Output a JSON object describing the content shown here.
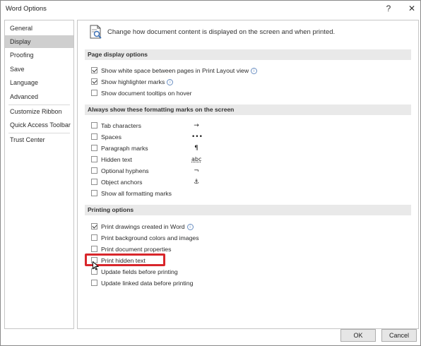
{
  "window": {
    "title": "Word Options",
    "help": "?",
    "close": "✕"
  },
  "sidebar": {
    "items": [
      {
        "label": "General"
      },
      {
        "label": "Display"
      },
      {
        "label": "Proofing"
      },
      {
        "label": "Save"
      },
      {
        "label": "Language"
      },
      {
        "label": "Advanced"
      },
      {
        "label": "Customize Ribbon"
      },
      {
        "label": "Quick Access Toolbar"
      },
      {
        "label": "Trust Center"
      }
    ],
    "selected": "Display"
  },
  "main": {
    "header": "Change how document content is displayed on the screen and when printed.",
    "sections": [
      {
        "title": "Page display options",
        "options": [
          {
            "label": "Show white space between pages in Print Layout view",
            "checked": true,
            "info": true
          },
          {
            "label": "Show highlighter marks",
            "checked": true,
            "info": true
          },
          {
            "label": "Show document tooltips on hover",
            "checked": false,
            "info": false
          }
        ]
      },
      {
        "title": "Always show these formatting marks on the screen",
        "options": [
          {
            "label": "Tab characters",
            "checked": false,
            "symbol": "→"
          },
          {
            "label": "Spaces",
            "checked": false,
            "symbol": "•••"
          },
          {
            "label": "Paragraph marks",
            "checked": false,
            "symbol": "¶"
          },
          {
            "label": "Hidden text",
            "checked": false,
            "symbol": "abc"
          },
          {
            "label": "Optional hyphens",
            "checked": false,
            "symbol": "¬"
          },
          {
            "label": "Object anchors",
            "checked": false,
            "symbol": "⚓"
          },
          {
            "label": "Show all formatting marks",
            "checked": false,
            "symbol": ""
          }
        ]
      },
      {
        "title": "Printing options",
        "options": [
          {
            "label": "Print drawings created in Word",
            "checked": true,
            "info": true
          },
          {
            "label": "Print background colors and images",
            "checked": false,
            "info": false
          },
          {
            "label": "Print document properties",
            "checked": false,
            "info": false
          },
          {
            "label": "Print hidden text",
            "checked": false,
            "info": false
          },
          {
            "label": "Update fields before printing",
            "checked": false,
            "info": false
          },
          {
            "label": "Update linked data before printing",
            "checked": false,
            "info": false
          }
        ]
      }
    ]
  },
  "footer": {
    "ok_label": "OK",
    "cancel_label": "Cancel"
  },
  "colors": {
    "highlight": "#d8262b",
    "section_bg": "#e9e9e9",
    "selected_nav": "#cfcfcf"
  }
}
